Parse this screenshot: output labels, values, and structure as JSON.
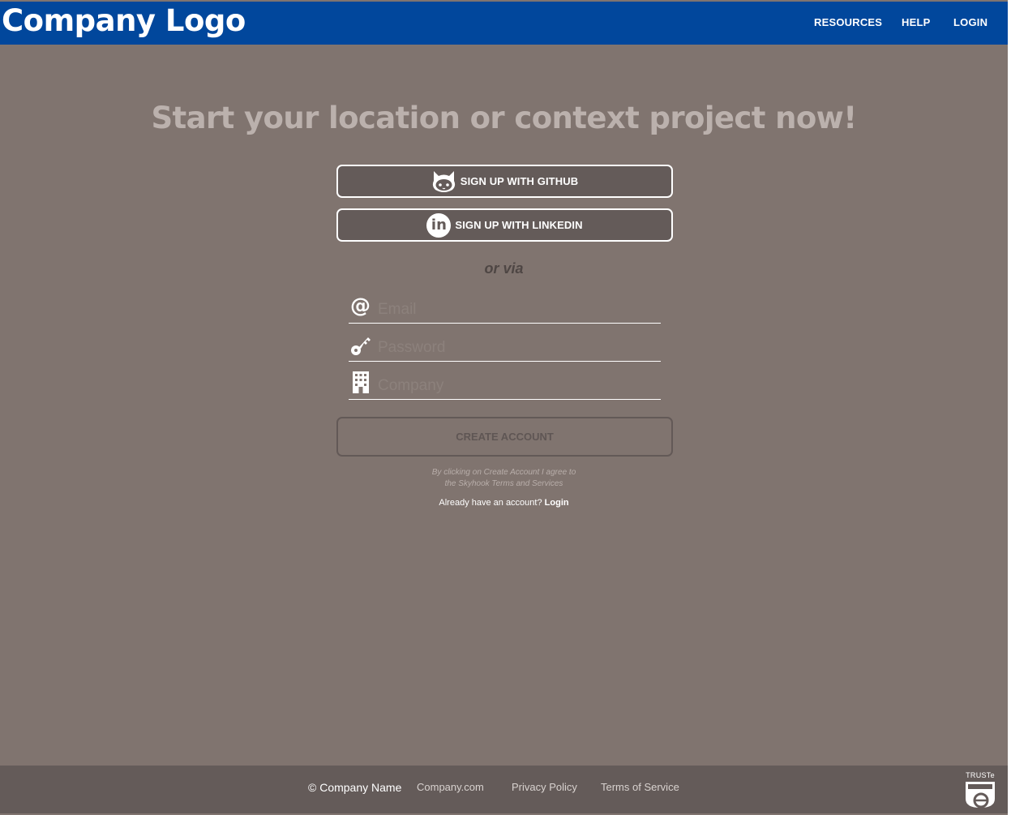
{
  "header": {
    "logo": "Company Logo",
    "nav": [
      "RESOURCES",
      "HELP",
      "LOGIN"
    ]
  },
  "main": {
    "title": "Start your location or context project now!",
    "github_button": "SIGN UP WITH GITHUB",
    "linkedin_button": "SIGN UP WITH LINKEDIN",
    "linkedin_icon_text": "in",
    "or_via": "or via",
    "email_placeholder": "Email",
    "password_placeholder": "Password",
    "company_placeholder": "Company",
    "at_symbol": "@",
    "create_button": "CREATE ACCOUNT",
    "terms_line1": "By clicking on Create Account I agree to",
    "terms_line2": "the Skyhook Terms and Services",
    "already_text": "Already have an account?",
    "login_link": "Login"
  },
  "footer": {
    "copyright": "© Company Name",
    "links": [
      "Company.com",
      "Privacy Policy",
      "Terms of Service"
    ],
    "truste": "TRUSTe"
  },
  "colors": {
    "header_bg": "#01479c",
    "page_bg": "#80746f",
    "button_bg": "#645b59",
    "footer_bg": "#645b59"
  },
  "icons": [
    "github-icon",
    "linkedin-icon",
    "at-icon",
    "key-icon",
    "building-icon",
    "truste-icon"
  ]
}
